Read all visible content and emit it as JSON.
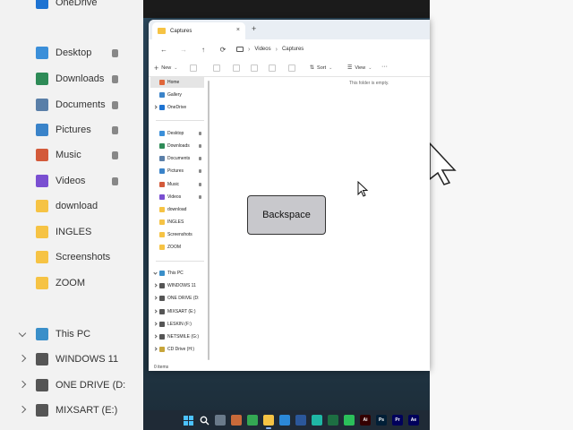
{
  "background_left": {
    "items": [
      {
        "label": "OneDrive",
        "color": "#1e73d2"
      },
      {
        "label": "Desktop",
        "color": "#3b8fd9",
        "pinned": true
      },
      {
        "label": "Downloads",
        "color": "#2e8b57",
        "pinned": true
      },
      {
        "label": "Documents",
        "color": "#5a7fa8",
        "pinned": true
      },
      {
        "label": "Pictures",
        "color": "#3a83c9",
        "pinned": true
      },
      {
        "label": "Music",
        "color": "#d35a3a",
        "pinned": true
      },
      {
        "label": "Videos",
        "color": "#7a4fd1",
        "pinned": true
      },
      {
        "label": "download",
        "color": "#f6c344"
      },
      {
        "label": "INGLES",
        "color": "#f6c344"
      },
      {
        "label": "Screenshots",
        "color": "#f6c344"
      },
      {
        "label": "ZOOM",
        "color": "#f6c344"
      },
      {
        "label": "This PC",
        "color": "#3a8fc9"
      },
      {
        "label": "WINDOWS 11",
        "color": "#555555"
      },
      {
        "label": "ONE DRIVE (D:",
        "color": "#555555"
      },
      {
        "label": "MIXSART (E:)",
        "color": "#555555"
      }
    ]
  },
  "window": {
    "tab_title": "Captures",
    "tab_close": "×",
    "new_tab": "+",
    "nav": {
      "back": "←",
      "forward": "→",
      "up": "↑",
      "refresh": "⟳"
    },
    "breadcrumbs": [
      "Videos",
      "Captures"
    ],
    "breadcrumb_sep": "›",
    "toolbar": {
      "new_label": "New",
      "new_glyph": "+",
      "sort_label": "Sort",
      "view_label": "View",
      "more_label": "···"
    },
    "empty_message": "This folder is empty.",
    "status": "0 items"
  },
  "nav_pane": {
    "items": [
      {
        "label": "Home",
        "icon": "home-icon",
        "color": "#e0663a",
        "selected": true
      },
      {
        "label": "Gallery",
        "icon": "gallery-icon",
        "color": "#3a83c9"
      },
      {
        "label": "OneDrive",
        "icon": "onedrive-icon",
        "color": "#1e73d2",
        "expandable": true
      },
      {
        "label": "Desktop",
        "icon": "desktop-icon",
        "color": "#3b8fd9",
        "pinned": true
      },
      {
        "label": "Downloads",
        "icon": "downloads-icon",
        "color": "#2e8b57",
        "pinned": true
      },
      {
        "label": "Documents",
        "icon": "documents-icon",
        "color": "#5a7fa8",
        "pinned": true
      },
      {
        "label": "Pictures",
        "icon": "pictures-icon",
        "color": "#3a83c9",
        "pinned": true
      },
      {
        "label": "Music",
        "icon": "music-icon",
        "color": "#d35a3a",
        "pinned": true
      },
      {
        "label": "Videos",
        "icon": "videos-icon",
        "color": "#7a4fd1",
        "pinned": true
      },
      {
        "label": "download",
        "icon": "folder-icon",
        "color": "#f6c344"
      },
      {
        "label": "INGLES",
        "icon": "folder-icon",
        "color": "#f6c344"
      },
      {
        "label": "Screenshots",
        "icon": "folder-icon",
        "color": "#f6c344"
      },
      {
        "label": "ZOOM",
        "icon": "folder-icon",
        "color": "#f6c344"
      },
      {
        "label": "This PC",
        "icon": "pc-icon",
        "color": "#3a8fc9",
        "expanded": true
      },
      {
        "label": "WINDOWS 11",
        "icon": "drive-icon",
        "color": "#555555",
        "expandable": true
      },
      {
        "label": "ONE DRIVE (D:",
        "icon": "drive-icon",
        "color": "#555555",
        "expandable": true
      },
      {
        "label": "MIXSART (E:)",
        "icon": "drive-icon",
        "color": "#555555",
        "expandable": true
      },
      {
        "label": "LESKIN (F:)",
        "icon": "drive-icon",
        "color": "#555555",
        "expandable": true
      },
      {
        "label": "NETSMILE (G:)",
        "icon": "drive-icon",
        "color": "#555555",
        "expandable": true
      },
      {
        "label": "CD Drive (H:)",
        "icon": "cd-drive-icon",
        "color": "#c7a53a",
        "expandable": true
      }
    ]
  },
  "key_overlay": {
    "label": "Backspace"
  },
  "taskbar": {
    "apps": [
      {
        "name": "start-button",
        "label": "",
        "color": "#4cc2ff"
      },
      {
        "name": "search-icon",
        "label": "",
        "color": "transparent"
      },
      {
        "name": "task-view-icon",
        "label": "",
        "color": "#6b7a8a"
      },
      {
        "name": "widgets-icon",
        "label": "",
        "color": "#c96a3a"
      },
      {
        "name": "chrome-icon",
        "label": "",
        "color": "#34a853"
      },
      {
        "name": "file-explorer-icon",
        "label": "",
        "color": "#f6c344",
        "active": true
      },
      {
        "name": "store-icon",
        "label": "",
        "color": "#2b88d8"
      },
      {
        "name": "word-icon",
        "label": "",
        "color": "#2b579a"
      },
      {
        "name": "capcut-icon",
        "label": "",
        "color": "#1fb7a5"
      },
      {
        "name": "excel-icon",
        "label": "",
        "color": "#1d6f42"
      },
      {
        "name": "maps-icon",
        "label": "",
        "color": "#2bbf5a"
      },
      {
        "name": "illustrator-icon",
        "label": "Ai",
        "color": "#330000"
      },
      {
        "name": "photoshop-icon",
        "label": "Ps",
        "color": "#001e36"
      },
      {
        "name": "premiere-icon",
        "label": "Pr",
        "color": "#00005b"
      },
      {
        "name": "after-effects-icon",
        "label": "Ae",
        "color": "#00005b"
      }
    ]
  }
}
